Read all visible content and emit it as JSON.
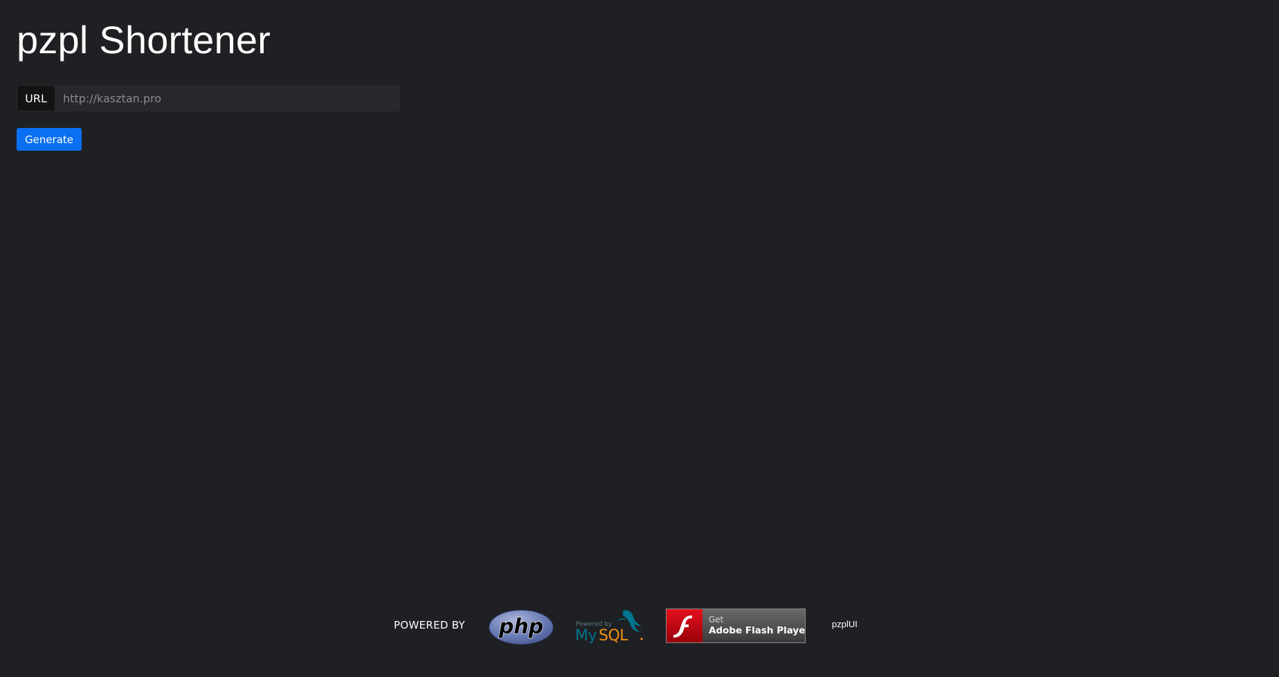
{
  "header": {
    "title": "pzpl Shortener"
  },
  "form": {
    "url_addon_label": "URL",
    "url_input_value": "",
    "url_input_placeholder": "http://kasztan.pro",
    "generate_label": "Generate"
  },
  "footer": {
    "powered_by": "POWERED BY",
    "logos": [
      {
        "name": "php-logo",
        "text": "php"
      },
      {
        "name": "mysql-logo",
        "text": "MySQL",
        "subtext": "Powered by"
      },
      {
        "name": "adobe-flash-player-badge",
        "text": "Adobe Flash Player",
        "subtext": "Get"
      }
    ],
    "credit": "pzplUI"
  },
  "colors": {
    "background": "#1f2023",
    "primary_button": "#0a6ff0",
    "input_background": "#27282b",
    "addon_background": "#151312",
    "php_blue": "#6c7eb7",
    "mysql_blue": "#00758f",
    "mysql_orange": "#f29111",
    "flash_red": "#cc0000"
  }
}
